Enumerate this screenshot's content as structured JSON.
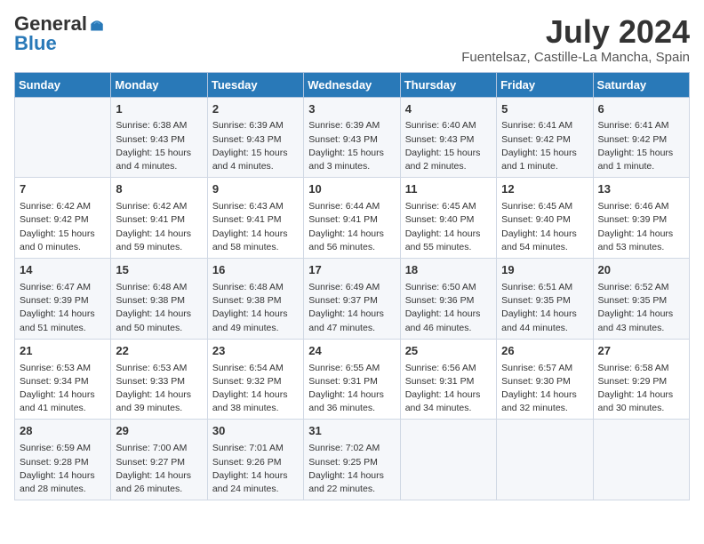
{
  "header": {
    "logo_general": "General",
    "logo_blue": "Blue",
    "month_year": "July 2024",
    "location": "Fuentelsaz, Castille-La Mancha, Spain"
  },
  "days_of_week": [
    "Sunday",
    "Monday",
    "Tuesday",
    "Wednesday",
    "Thursday",
    "Friday",
    "Saturday"
  ],
  "weeks": [
    [
      {
        "day": "",
        "content": ""
      },
      {
        "day": "1",
        "content": "Sunrise: 6:38 AM\nSunset: 9:43 PM\nDaylight: 15 hours\nand 4 minutes."
      },
      {
        "day": "2",
        "content": "Sunrise: 6:39 AM\nSunset: 9:43 PM\nDaylight: 15 hours\nand 4 minutes."
      },
      {
        "day": "3",
        "content": "Sunrise: 6:39 AM\nSunset: 9:43 PM\nDaylight: 15 hours\nand 3 minutes."
      },
      {
        "day": "4",
        "content": "Sunrise: 6:40 AM\nSunset: 9:43 PM\nDaylight: 15 hours\nand 2 minutes."
      },
      {
        "day": "5",
        "content": "Sunrise: 6:41 AM\nSunset: 9:42 PM\nDaylight: 15 hours\nand 1 minute."
      },
      {
        "day": "6",
        "content": "Sunrise: 6:41 AM\nSunset: 9:42 PM\nDaylight: 15 hours\nand 1 minute."
      }
    ],
    [
      {
        "day": "7",
        "content": "Sunrise: 6:42 AM\nSunset: 9:42 PM\nDaylight: 15 hours\nand 0 minutes."
      },
      {
        "day": "8",
        "content": "Sunrise: 6:42 AM\nSunset: 9:41 PM\nDaylight: 14 hours\nand 59 minutes."
      },
      {
        "day": "9",
        "content": "Sunrise: 6:43 AM\nSunset: 9:41 PM\nDaylight: 14 hours\nand 58 minutes."
      },
      {
        "day": "10",
        "content": "Sunrise: 6:44 AM\nSunset: 9:41 PM\nDaylight: 14 hours\nand 56 minutes."
      },
      {
        "day": "11",
        "content": "Sunrise: 6:45 AM\nSunset: 9:40 PM\nDaylight: 14 hours\nand 55 minutes."
      },
      {
        "day": "12",
        "content": "Sunrise: 6:45 AM\nSunset: 9:40 PM\nDaylight: 14 hours\nand 54 minutes."
      },
      {
        "day": "13",
        "content": "Sunrise: 6:46 AM\nSunset: 9:39 PM\nDaylight: 14 hours\nand 53 minutes."
      }
    ],
    [
      {
        "day": "14",
        "content": "Sunrise: 6:47 AM\nSunset: 9:39 PM\nDaylight: 14 hours\nand 51 minutes."
      },
      {
        "day": "15",
        "content": "Sunrise: 6:48 AM\nSunset: 9:38 PM\nDaylight: 14 hours\nand 50 minutes."
      },
      {
        "day": "16",
        "content": "Sunrise: 6:48 AM\nSunset: 9:38 PM\nDaylight: 14 hours\nand 49 minutes."
      },
      {
        "day": "17",
        "content": "Sunrise: 6:49 AM\nSunset: 9:37 PM\nDaylight: 14 hours\nand 47 minutes."
      },
      {
        "day": "18",
        "content": "Sunrise: 6:50 AM\nSunset: 9:36 PM\nDaylight: 14 hours\nand 46 minutes."
      },
      {
        "day": "19",
        "content": "Sunrise: 6:51 AM\nSunset: 9:35 PM\nDaylight: 14 hours\nand 44 minutes."
      },
      {
        "day": "20",
        "content": "Sunrise: 6:52 AM\nSunset: 9:35 PM\nDaylight: 14 hours\nand 43 minutes."
      }
    ],
    [
      {
        "day": "21",
        "content": "Sunrise: 6:53 AM\nSunset: 9:34 PM\nDaylight: 14 hours\nand 41 minutes."
      },
      {
        "day": "22",
        "content": "Sunrise: 6:53 AM\nSunset: 9:33 PM\nDaylight: 14 hours\nand 39 minutes."
      },
      {
        "day": "23",
        "content": "Sunrise: 6:54 AM\nSunset: 9:32 PM\nDaylight: 14 hours\nand 38 minutes."
      },
      {
        "day": "24",
        "content": "Sunrise: 6:55 AM\nSunset: 9:31 PM\nDaylight: 14 hours\nand 36 minutes."
      },
      {
        "day": "25",
        "content": "Sunrise: 6:56 AM\nSunset: 9:31 PM\nDaylight: 14 hours\nand 34 minutes."
      },
      {
        "day": "26",
        "content": "Sunrise: 6:57 AM\nSunset: 9:30 PM\nDaylight: 14 hours\nand 32 minutes."
      },
      {
        "day": "27",
        "content": "Sunrise: 6:58 AM\nSunset: 9:29 PM\nDaylight: 14 hours\nand 30 minutes."
      }
    ],
    [
      {
        "day": "28",
        "content": "Sunrise: 6:59 AM\nSunset: 9:28 PM\nDaylight: 14 hours\nand 28 minutes."
      },
      {
        "day": "29",
        "content": "Sunrise: 7:00 AM\nSunset: 9:27 PM\nDaylight: 14 hours\nand 26 minutes."
      },
      {
        "day": "30",
        "content": "Sunrise: 7:01 AM\nSunset: 9:26 PM\nDaylight: 14 hours\nand 24 minutes."
      },
      {
        "day": "31",
        "content": "Sunrise: 7:02 AM\nSunset: 9:25 PM\nDaylight: 14 hours\nand 22 minutes."
      },
      {
        "day": "",
        "content": ""
      },
      {
        "day": "",
        "content": ""
      },
      {
        "day": "",
        "content": ""
      }
    ]
  ]
}
